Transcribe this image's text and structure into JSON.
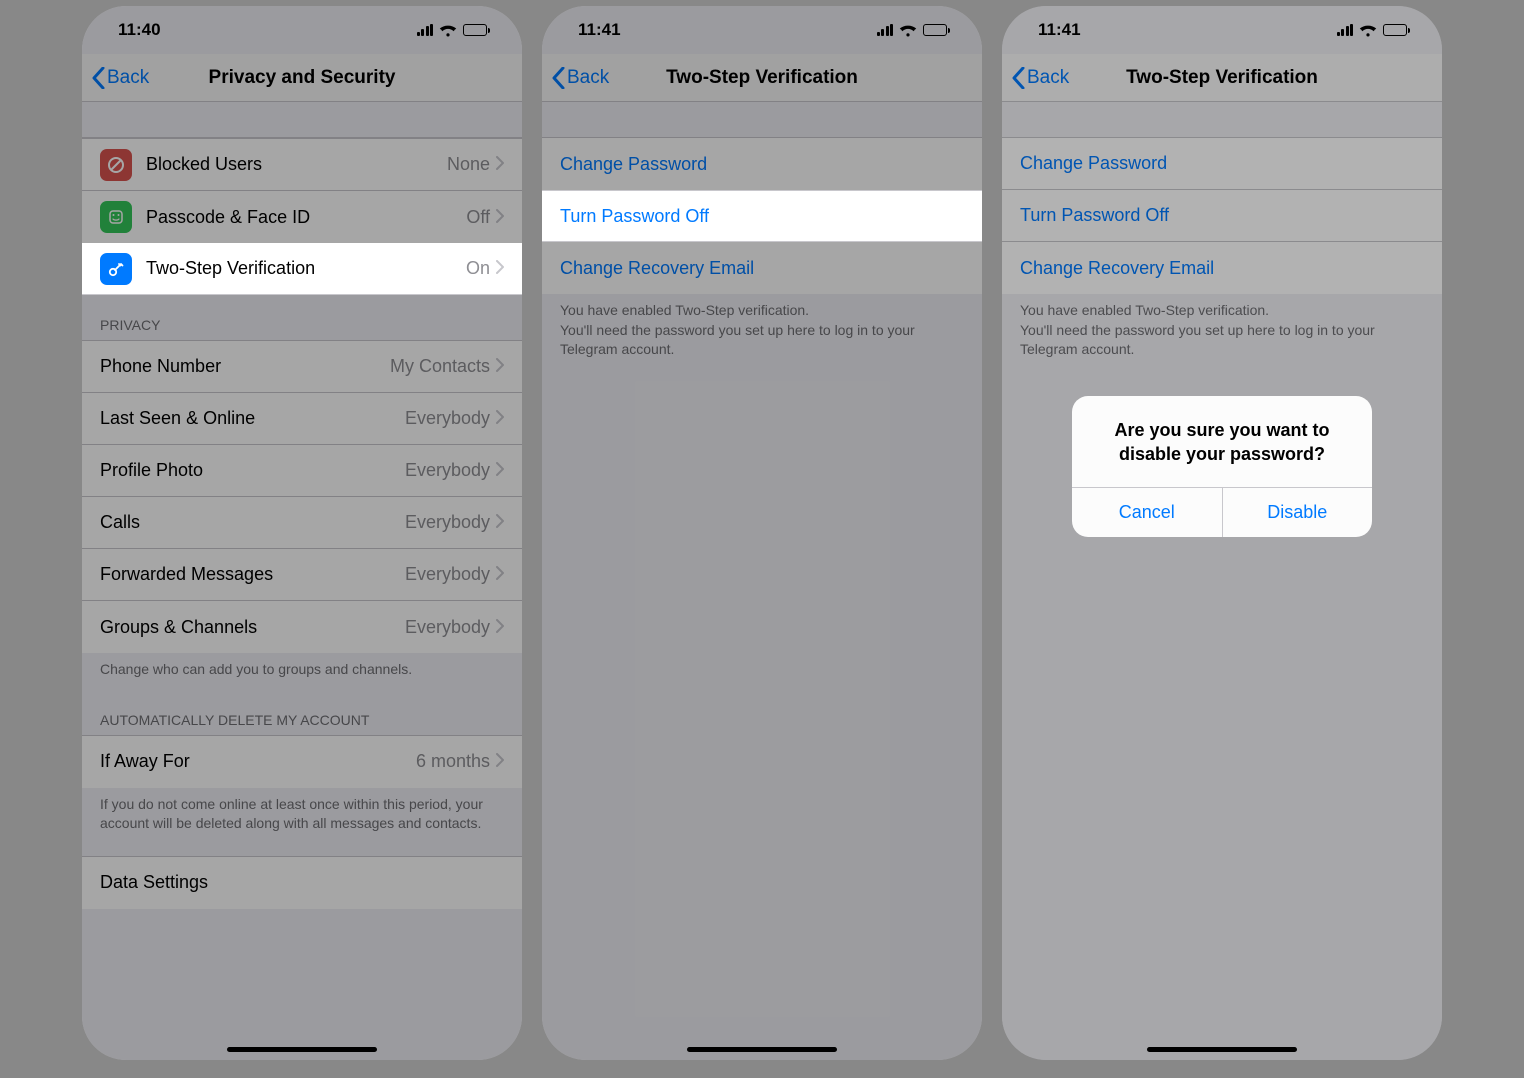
{
  "screen1": {
    "time": "11:40",
    "back": "Back",
    "title": "Privacy and Security",
    "rows_security": [
      {
        "label": "Blocked Users",
        "value": "None",
        "icon": "blocked",
        "iconBg": "#d9534f"
      },
      {
        "label": "Passcode & Face ID",
        "value": "Off",
        "icon": "passcode",
        "iconBg": "#34c759"
      },
      {
        "label": "Two-Step Verification",
        "value": "On",
        "icon": "key",
        "iconBg": "#007aff"
      }
    ],
    "privacy_header": "PRIVACY",
    "rows_privacy": [
      {
        "label": "Phone Number",
        "value": "My Contacts"
      },
      {
        "label": "Last Seen & Online",
        "value": "Everybody"
      },
      {
        "label": "Profile Photo",
        "value": "Everybody"
      },
      {
        "label": "Calls",
        "value": "Everybody"
      },
      {
        "label": "Forwarded Messages",
        "value": "Everybody"
      },
      {
        "label": "Groups & Channels",
        "value": "Everybody"
      }
    ],
    "privacy_footer": "Change who can add you to groups and channels.",
    "autodelete_header": "AUTOMATICALLY DELETE MY ACCOUNT",
    "rows_autodelete": [
      {
        "label": "If Away For",
        "value": "6 months"
      }
    ],
    "autodelete_footer": "If you do not come online at least once within this period, your account will be deleted along with all messages and contacts.",
    "data_settings_label": "Data Settings"
  },
  "screen2": {
    "time": "11:41",
    "back": "Back",
    "title": "Two-Step Verification",
    "rows": [
      {
        "label": "Change Password"
      },
      {
        "label": "Turn Password Off"
      },
      {
        "label": "Change Recovery Email"
      }
    ],
    "footer": "You have enabled Two-Step verification.\nYou'll need the password you set up here to log in to your Telegram account."
  },
  "screen3": {
    "time": "11:41",
    "back": "Back",
    "title": "Two-Step Verification",
    "rows": [
      {
        "label": "Change Password"
      },
      {
        "label": "Turn Password Off"
      },
      {
        "label": "Change Recovery Email"
      }
    ],
    "footer": "You have enabled Two-Step verification.\nYou'll need the password you set up here to log in to your Telegram account.",
    "alert_title": "Are you sure you want to disable your password?",
    "alert_cancel": "Cancel",
    "alert_confirm": "Disable"
  }
}
